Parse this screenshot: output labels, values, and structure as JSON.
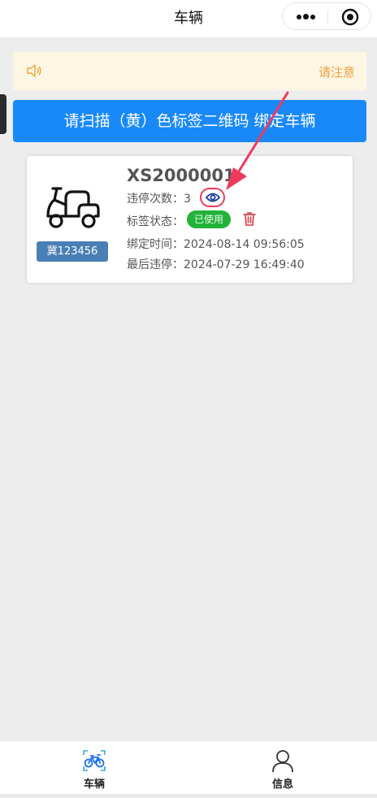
{
  "header": {
    "title": "车辆"
  },
  "notice": {
    "text": "请注意"
  },
  "scan_button": {
    "label": "请扫描（黄）色标签二维码 绑定车辆"
  },
  "vehicle_card": {
    "vehicle_id": "XS2000001",
    "plate": "冀123456",
    "violations_label": "违停次数：",
    "violations_count": "3",
    "status_label": "标签状态：",
    "status_value": "已使用",
    "status_color": "#22b33a",
    "bind_time_label": "绑定时间：",
    "bind_time": "2024-08-14 09:56:05",
    "last_violation_label": "最后违停：",
    "last_violation": "2024-07-29 16:49:40"
  },
  "tabbar": {
    "tabs": [
      {
        "label": "车辆",
        "icon": "bicycle-icon",
        "active": true
      },
      {
        "label": "信息",
        "icon": "user-icon",
        "active": false
      }
    ]
  },
  "colors": {
    "primary": "#1989fa",
    "notice_text": "#f0a03c",
    "notice_bg": "#fdf6e3",
    "annotation": "#ee3b5c",
    "plate_bg": "#4a7fb5"
  }
}
